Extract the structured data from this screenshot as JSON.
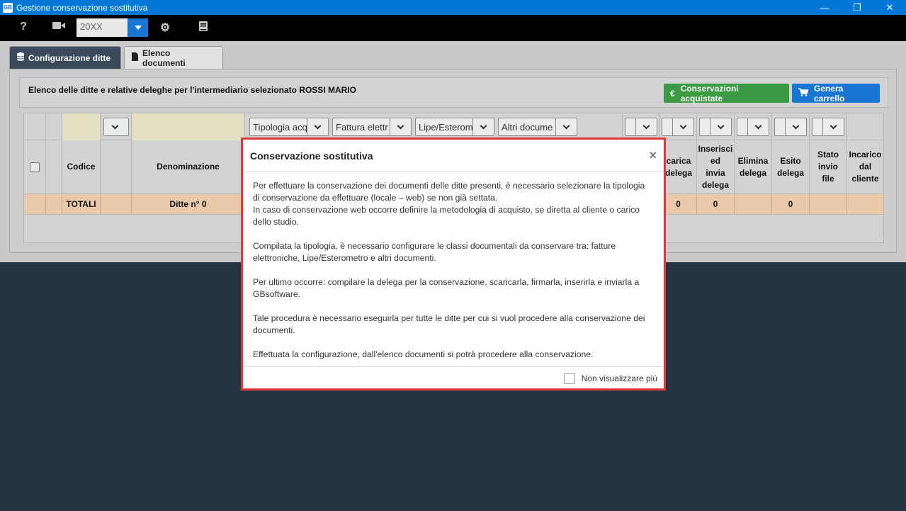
{
  "window": {
    "title": "Gestione conservazione sostitutiva",
    "icon_label": "GB",
    "minimize": "—",
    "restore": "❐",
    "close": "✕"
  },
  "toolbar": {
    "help_icon": "?",
    "video_icon": "■",
    "settings_icon": "⚙",
    "book_icon": "▤",
    "year_value": "20XX"
  },
  "tabs": [
    {
      "label": "Configurazione ditte",
      "icon": "database-icon",
      "active": true
    },
    {
      "label": "Elenco documenti",
      "icon": "document-icon",
      "active": false
    }
  ],
  "panel": {
    "info_text": "Elenco delle ditte e relative deleghe per l'intermediario selezionato ROSSI MARIO",
    "btn_purchased_label": "Conservazioni acquistate",
    "btn_purchased_icon": "€",
    "btn_cart_label": "Genera carrello",
    "btn_cart_icon": "🛒"
  },
  "grid": {
    "filters": {
      "tipologia": "Tipologia acq",
      "fattura": "Fattura elettr",
      "lipe": "Lipe/Esterom",
      "altri": "Altri docume"
    },
    "headers": {
      "codice": "Codice",
      "denominazione": "Denominazione",
      "scarica_delega": "carica\ndelega",
      "inserisci": "Inserisci\ned\ninvia\ndelega",
      "elimina": "Elimina\ndelega",
      "esito": "Esito\ndelega",
      "stato": "Stato\ninvio\nfile",
      "incarico": "Incarico\ndal\ncliente"
    },
    "totals": {
      "label": "TOTALI",
      "ditte": "Ditte n° 0",
      "scarica": "0",
      "inserisci": "0",
      "esito": "0"
    }
  },
  "modal": {
    "title": "Conservazione sostitutiva",
    "close": "×",
    "paragraphs": [
      "Per effettuare la conservazione dei documenti delle ditte presenti, è necessario selezionare la tipologia di conservazione da effettuare (locale – web) se non già settata.\nIn caso di conservazione web occorre definire la metodologia di acquisto, se diretta al cliente o carico dello studio.",
      "Compilata la tipologia, è necessario configurare le classi documentali da conservare tra: fatture elettroniche, Lipe/Esterometro e altri documenti.",
      "Per ultimo occorre: compilare la delega per la conservazione, scaricarla, firmarla, inserirla e inviarla a GBsoftware.",
      "Tale procedura è necessario eseguirla per tutte le ditte per cui si vuol procedere alla conservazione dei documenti.",
      "Effettuata la configurazione, dall'elenco documenti si potrà procedere alla conservazione."
    ],
    "dont_show_label": "Non visualizzare più"
  }
}
